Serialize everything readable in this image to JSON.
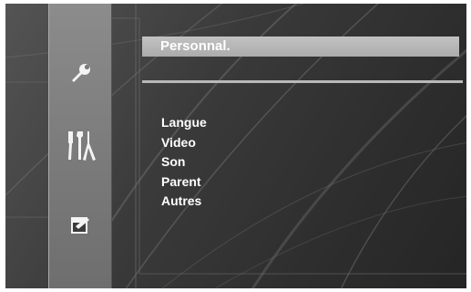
{
  "header": {
    "title": "Personnal."
  },
  "sidebar": {
    "icons": [
      {
        "name": "wrench-icon"
      },
      {
        "name": "tools-icon"
      },
      {
        "name": "exit-icon"
      }
    ]
  },
  "menu": {
    "items": [
      {
        "label": "Langue"
      },
      {
        "label": "Video"
      },
      {
        "label": "Son"
      },
      {
        "label": "Parent"
      },
      {
        "label": "Autres"
      }
    ]
  },
  "colors": {
    "background": "#3a3a3a",
    "sidebar": "#7c7c7c",
    "header_bar": "#b4b4b4",
    "text": "#ffffff"
  }
}
